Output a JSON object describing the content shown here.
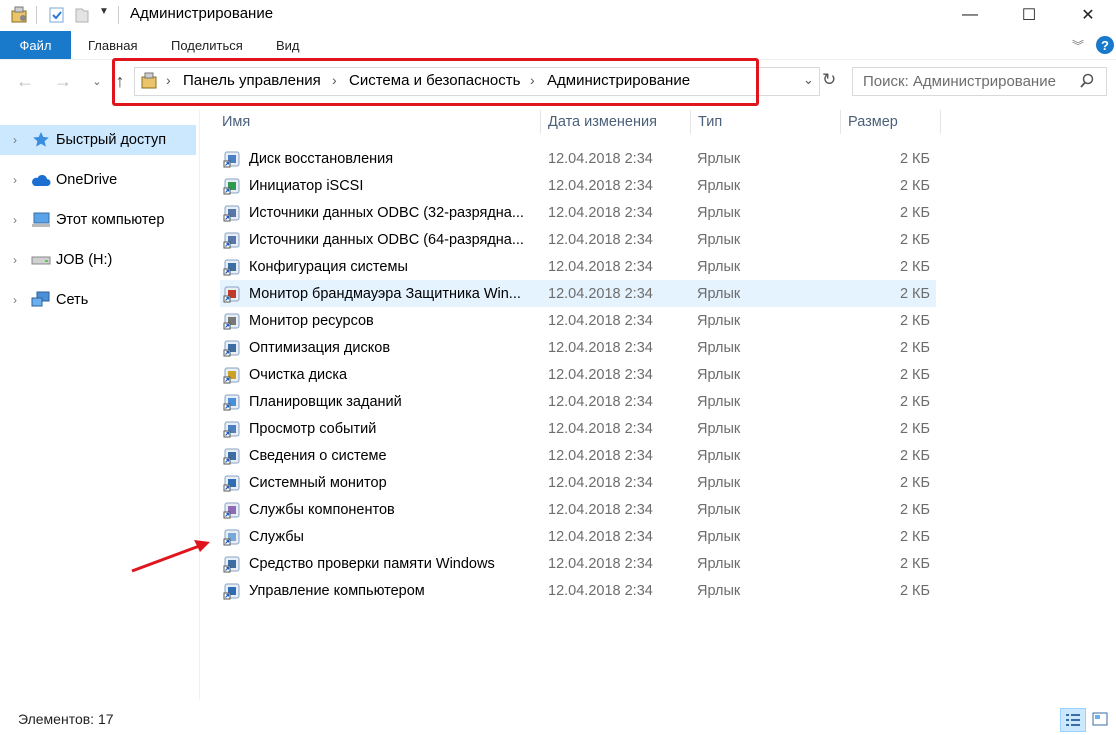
{
  "window": {
    "title": "Администрирование",
    "minimize": "—",
    "maximize": "☐",
    "close": "✕"
  },
  "ribbon": {
    "tabs": [
      "Файл",
      "Главная",
      "Поделиться",
      "Вид"
    ],
    "help": "?"
  },
  "address": {
    "crumbs": [
      "Панель управления",
      "Система и безопасность",
      "Администрирование"
    ],
    "separator": "›"
  },
  "search": {
    "placeholder": "Поиск: Администрирование"
  },
  "sidebar": {
    "items": [
      {
        "label": "Быстрый доступ",
        "icon": "star-icon"
      },
      {
        "label": "OneDrive",
        "icon": "cloud-icon"
      },
      {
        "label": "Этот компьютер",
        "icon": "computer-icon"
      },
      {
        "label": "JOB (H:)",
        "icon": "drive-icon"
      },
      {
        "label": "Сеть",
        "icon": "network-icon"
      }
    ]
  },
  "columns": {
    "name": "Имя",
    "date": "Дата изменения",
    "type": "Тип",
    "size": "Размер"
  },
  "files": [
    {
      "name": "Диск восстановления",
      "date": "12.04.2018 2:34",
      "type": "Ярлык",
      "size": "2 КБ"
    },
    {
      "name": "Инициатор iSCSI",
      "date": "12.04.2018 2:34",
      "type": "Ярлык",
      "size": "2 КБ"
    },
    {
      "name": "Источники данных ODBC (32-разрядна...",
      "date": "12.04.2018 2:34",
      "type": "Ярлык",
      "size": "2 КБ"
    },
    {
      "name": "Источники данных ODBC (64-разрядна...",
      "date": "12.04.2018 2:34",
      "type": "Ярлык",
      "size": "2 КБ"
    },
    {
      "name": "Конфигурация системы",
      "date": "12.04.2018 2:34",
      "type": "Ярлык",
      "size": "2 КБ"
    },
    {
      "name": "Монитор брандмауэра Защитника Win...",
      "date": "12.04.2018 2:34",
      "type": "Ярлык",
      "size": "2 КБ"
    },
    {
      "name": "Монитор ресурсов",
      "date": "12.04.2018 2:34",
      "type": "Ярлык",
      "size": "2 КБ"
    },
    {
      "name": "Оптимизация дисков",
      "date": "12.04.2018 2:34",
      "type": "Ярлык",
      "size": "2 КБ"
    },
    {
      "name": "Очистка диска",
      "date": "12.04.2018 2:34",
      "type": "Ярлык",
      "size": "2 КБ"
    },
    {
      "name": "Планировщик заданий",
      "date": "12.04.2018 2:34",
      "type": "Ярлык",
      "size": "2 КБ"
    },
    {
      "name": "Просмотр событий",
      "date": "12.04.2018 2:34",
      "type": "Ярлык",
      "size": "2 КБ"
    },
    {
      "name": "Сведения о системе",
      "date": "12.04.2018 2:34",
      "type": "Ярлык",
      "size": "2 КБ"
    },
    {
      "name": "Системный монитор",
      "date": "12.04.2018 2:34",
      "type": "Ярлык",
      "size": "2 КБ"
    },
    {
      "name": "Службы компонентов",
      "date": "12.04.2018 2:34",
      "type": "Ярлык",
      "size": "2 КБ"
    },
    {
      "name": "Службы",
      "date": "12.04.2018 2:34",
      "type": "Ярлык",
      "size": "2 КБ"
    },
    {
      "name": "Средство проверки памяти Windows",
      "date": "12.04.2018 2:34",
      "type": "Ярлык",
      "size": "2 КБ"
    },
    {
      "name": "Управление компьютером",
      "date": "12.04.2018 2:34",
      "type": "Ярлык",
      "size": "2 КБ"
    }
  ],
  "status": {
    "items_count": "Элементов: 17"
  },
  "colors": {
    "accent": "#1979ca",
    "selection": "#cce8ff",
    "hover": "#e5f3ff",
    "annotation": "#e0141c"
  }
}
